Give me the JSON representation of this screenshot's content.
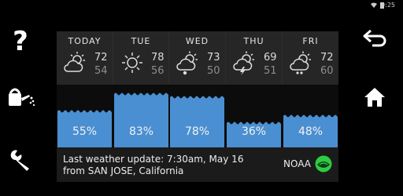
{
  "status": {
    "time": "9:25",
    "icons": [
      "wifi-icon",
      "battery-icon"
    ]
  },
  "left_buttons": [
    {
      "name": "help-button",
      "icon": "question-mark-icon"
    },
    {
      "name": "watering-button",
      "icon": "watering-can-icon"
    },
    {
      "name": "settings-button",
      "icon": "wrench-icon"
    }
  ],
  "right_buttons": [
    {
      "name": "back-button",
      "icon": "back-arrow-icon"
    },
    {
      "name": "home-button",
      "icon": "home-icon"
    }
  ],
  "forecast": [
    {
      "day": "TODAY",
      "high": "72",
      "low": "54",
      "icon": "partly-cloudy-icon",
      "rain_chance": "55%",
      "rain_fraction": 0.55
    },
    {
      "day": "TUE",
      "high": "78",
      "low": "56",
      "icon": "sunny-icon",
      "rain_chance": "83%",
      "rain_fraction": 0.83
    },
    {
      "day": "WED",
      "high": "73",
      "low": "50",
      "icon": "partly-cloudy-rain-icon",
      "rain_chance": "78%",
      "rain_fraction": 0.78
    },
    {
      "day": "THU",
      "high": "69",
      "low": "51",
      "icon": "thunderstorm-icon",
      "rain_chance": "36%",
      "rain_fraction": 0.36
    },
    {
      "day": "FRI",
      "high": "72",
      "low": "60",
      "icon": "partly-cloudy-rain-icon",
      "rain_chance": "48%",
      "rain_fraction": 0.48
    }
  ],
  "footer": {
    "update_line1": "Last weather update: 7:30am, May 16",
    "update_line2": "from SAN JOSE, California",
    "source_label": "NOAA",
    "source_icon": "noaa-logo-icon"
  },
  "colors": {
    "water": "#4a8fd1",
    "panel": "#1b1b1b",
    "noaa_green": "#2ecc40"
  }
}
